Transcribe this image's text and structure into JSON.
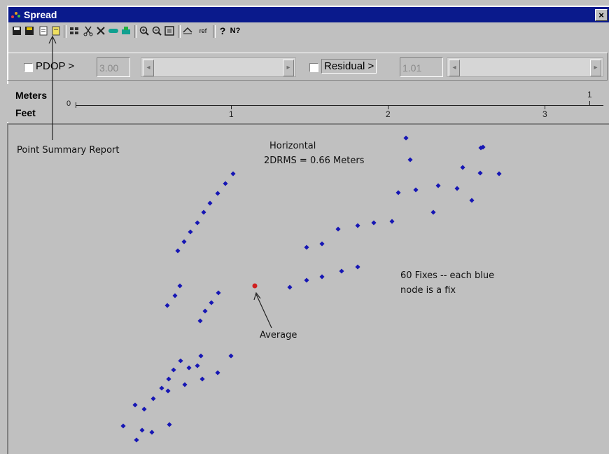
{
  "window": {
    "title": "Spread",
    "close_label": "×"
  },
  "toolbar": {
    "icons": [
      "save-icon",
      "save-as-icon",
      "point-summary-report-icon",
      "report-icon",
      "grid-icon",
      "cut-icon",
      "delete-icon",
      "link-icon",
      "group-icon",
      "zoom-in-icon",
      "zoom-out-icon",
      "fit-icon",
      "measure-icon",
      "ref-icon",
      "help-icon",
      "context-help-icon"
    ],
    "ref_label": "ref",
    "help_label": "?",
    "context_help_label": "N?"
  },
  "filters": {
    "pdop_label": "PDOP >",
    "pdop_value": "3.00",
    "residual_label": "Residual >",
    "residual_value": "1.01"
  },
  "scale": {
    "meters_label": "Meters",
    "feet_label": "Feet",
    "zero_label": "0",
    "meter_ticks": [
      "1"
    ],
    "feet_ticks": [
      "1",
      "2",
      "3"
    ]
  },
  "annotations": {
    "point_summary": "Point Summary Report",
    "horizontal": "Horizontal",
    "drms": "2DRMS = 0.66 Meters",
    "fixes_line1": "60 Fixes -- each blue",
    "fixes_line2": "node is a fix",
    "average": "Average"
  },
  "colors": {
    "fix": "#1616b4",
    "average": "#d02020",
    "titlebar": "#0a1a8c"
  },
  "fixes_count": 60
}
